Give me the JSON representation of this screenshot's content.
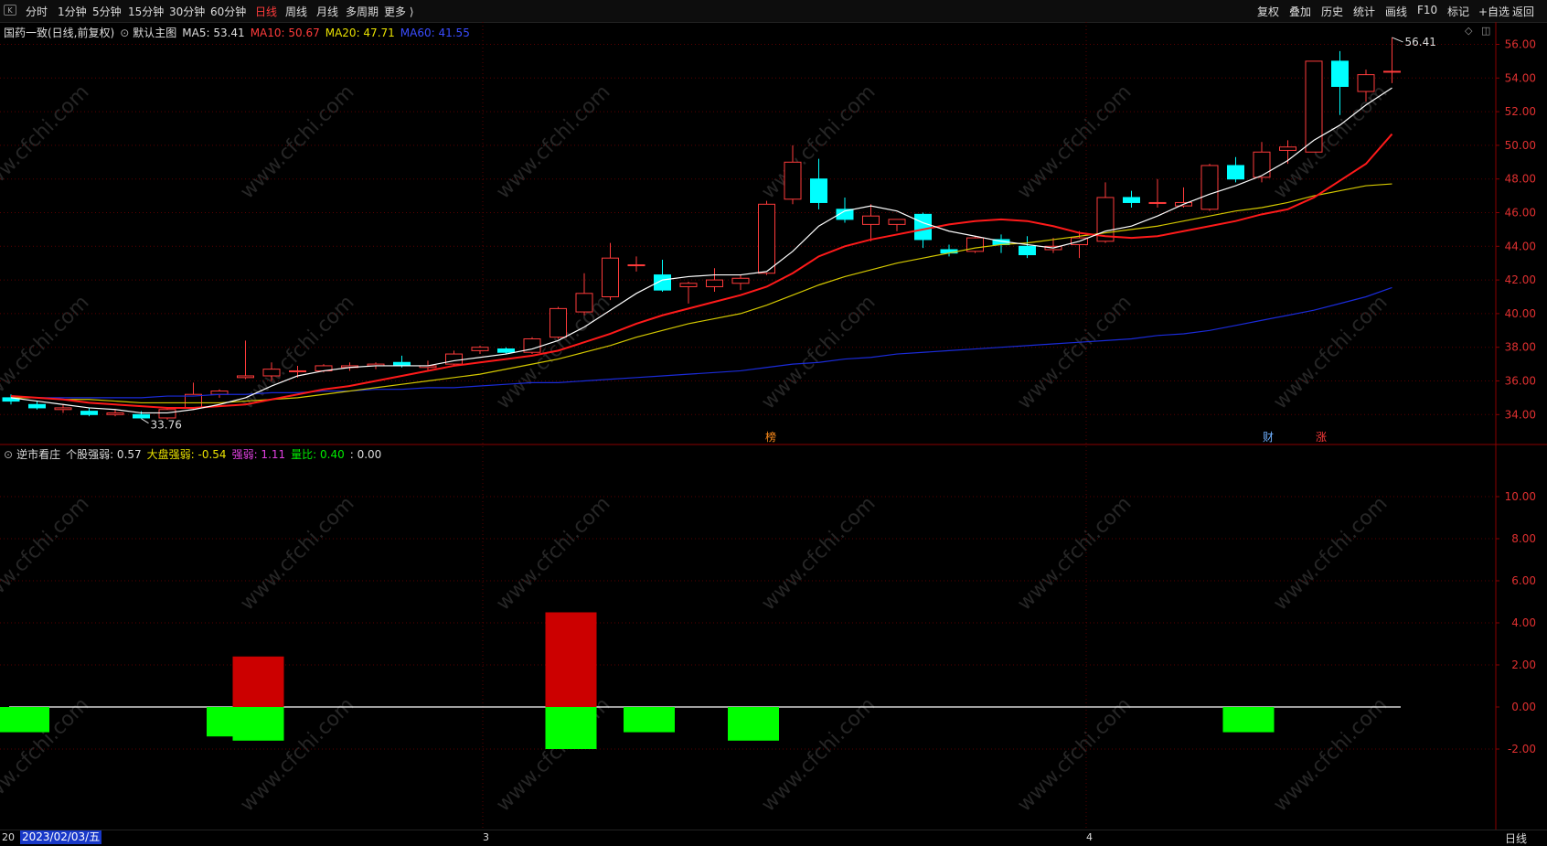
{
  "toolbar": {
    "icon_label": "K",
    "left_items": [
      "分时",
      "1分钟",
      "5分钟",
      "15分钟",
      "30分钟",
      "60分钟",
      "日线",
      "周线",
      "月线",
      "多周期",
      "更多 ⟩"
    ],
    "active_index": 6,
    "right_items": [
      "复权",
      "叠加",
      "历史",
      "统计",
      "画线",
      "F10",
      "标记",
      "+自选",
      "返回"
    ]
  },
  "main_legend": {
    "title": "国药一致(日线,前复权)",
    "indicator": "默认主图",
    "ma5": "MA5: 53.41",
    "ma10": "MA10: 50.67",
    "ma20": "MA20: 47.71",
    "ma60": "MA60: 41.55"
  },
  "sub_legend": {
    "title": "逆市看庄",
    "item1": "个股强弱: 0.57",
    "item2": "大盘强弱: -0.54",
    "item3": "强弱: 1.11",
    "item4": "量比: 0.40",
    "item5": ": 0.00"
  },
  "price_axis": [
    "56.00",
    "54.00",
    "52.00",
    "50.00",
    "48.00",
    "46.00",
    "44.00",
    "42.00",
    "40.00",
    "38.00",
    "36.00",
    "34.00"
  ],
  "sub_axis": [
    "10.00",
    "8.00",
    "6.00",
    "4.00",
    "2.00",
    "0.00",
    "-2.00"
  ],
  "annotations": {
    "high": "56.41",
    "low": "33.76"
  },
  "markers": {
    "m1": "榜",
    "m2": "财",
    "m3": "涨"
  },
  "watermark": "www.cfchi.com",
  "bottom": {
    "left_stub": "20",
    "date": "2023/02/03/五",
    "tick_3": "3",
    "tick_4": "4",
    "period": "日线"
  },
  "colors": {
    "up": "#ff3b3b",
    "down": "#00ffff",
    "ma5": "#ffffff",
    "ma10": "#ff1a1a",
    "ma20": "#d4c800",
    "ma60": "#1a2bd8",
    "pos_bar": "#cc0000",
    "neg_bar": "#00ff00"
  },
  "chart_data": [
    {
      "type": "candlestick",
      "title": "国药一致(日线,前复权)",
      "ylim": [
        33,
        57.5
      ],
      "candles": [
        {
          "o": 35.0,
          "h": 35.2,
          "l": 34.6,
          "c": 34.8
        },
        {
          "o": 34.6,
          "h": 34.8,
          "l": 34.3,
          "c": 34.4
        },
        {
          "o": 34.3,
          "h": 34.6,
          "l": 34.1,
          "c": 34.4
        },
        {
          "o": 34.2,
          "h": 34.4,
          "l": 33.9,
          "c": 34.0
        },
        {
          "o": 34.0,
          "h": 34.3,
          "l": 33.9,
          "c": 34.1
        },
        {
          "o": 34.0,
          "h": 34.2,
          "l": 33.76,
          "c": 33.8
        },
        {
          "o": 33.8,
          "h": 34.4,
          "l": 33.7,
          "c": 34.3
        },
        {
          "o": 34.4,
          "h": 35.9,
          "l": 34.3,
          "c": 35.2
        },
        {
          "o": 35.2,
          "h": 35.5,
          "l": 35.0,
          "c": 35.4
        },
        {
          "o": 36.2,
          "h": 38.4,
          "l": 36.1,
          "c": 36.3
        },
        {
          "o": 36.3,
          "h": 37.1,
          "l": 36.0,
          "c": 36.7
        },
        {
          "o": 36.6,
          "h": 36.9,
          "l": 36.2,
          "c": 36.6
        },
        {
          "o": 36.6,
          "h": 37.0,
          "l": 36.5,
          "c": 36.9
        },
        {
          "o": 36.8,
          "h": 37.1,
          "l": 36.6,
          "c": 36.9
        },
        {
          "o": 36.9,
          "h": 37.1,
          "l": 36.7,
          "c": 37.0
        },
        {
          "o": 37.1,
          "h": 37.5,
          "l": 36.8,
          "c": 36.9
        },
        {
          "o": 36.8,
          "h": 37.2,
          "l": 36.6,
          "c": 36.9
        },
        {
          "o": 37.0,
          "h": 37.8,
          "l": 36.9,
          "c": 37.6
        },
        {
          "o": 37.8,
          "h": 38.1,
          "l": 37.6,
          "c": 38.0
        },
        {
          "o": 37.9,
          "h": 38.0,
          "l": 37.6,
          "c": 37.7
        },
        {
          "o": 37.7,
          "h": 38.6,
          "l": 37.6,
          "c": 38.5
        },
        {
          "o": 38.6,
          "h": 40.4,
          "l": 38.5,
          "c": 40.3
        },
        {
          "o": 40.1,
          "h": 42.4,
          "l": 39.9,
          "c": 41.2
        },
        {
          "o": 41.0,
          "h": 44.2,
          "l": 40.8,
          "c": 43.3
        },
        {
          "o": 42.9,
          "h": 43.4,
          "l": 42.5,
          "c": 42.9
        },
        {
          "o": 42.3,
          "h": 43.2,
          "l": 41.3,
          "c": 41.4
        },
        {
          "o": 41.6,
          "h": 41.9,
          "l": 40.6,
          "c": 41.8
        },
        {
          "o": 41.6,
          "h": 42.7,
          "l": 41.3,
          "c": 42.0
        },
        {
          "o": 41.8,
          "h": 42.3,
          "l": 41.4,
          "c": 42.1
        },
        {
          "o": 42.4,
          "h": 46.7,
          "l": 42.3,
          "c": 46.5
        },
        {
          "o": 46.8,
          "h": 50.0,
          "l": 46.5,
          "c": 49.0
        },
        {
          "o": 48.0,
          "h": 49.2,
          "l": 46.2,
          "c": 46.6
        },
        {
          "o": 46.2,
          "h": 46.9,
          "l": 45.4,
          "c": 45.6
        },
        {
          "o": 45.3,
          "h": 46.5,
          "l": 44.3,
          "c": 45.8
        },
        {
          "o": 45.3,
          "h": 45.6,
          "l": 44.9,
          "c": 45.6
        },
        {
          "o": 45.9,
          "h": 46.0,
          "l": 43.9,
          "c": 44.4
        },
        {
          "o": 43.8,
          "h": 44.1,
          "l": 43.4,
          "c": 43.6
        },
        {
          "o": 43.7,
          "h": 44.6,
          "l": 43.6,
          "c": 44.5
        },
        {
          "o": 44.4,
          "h": 44.7,
          "l": 43.6,
          "c": 44.1
        },
        {
          "o": 44.0,
          "h": 44.6,
          "l": 43.3,
          "c": 43.5
        },
        {
          "o": 43.8,
          "h": 44.5,
          "l": 43.6,
          "c": 44.0
        },
        {
          "o": 44.1,
          "h": 44.9,
          "l": 43.3,
          "c": 44.5
        },
        {
          "o": 44.3,
          "h": 47.8,
          "l": 44.2,
          "c": 46.9
        },
        {
          "o": 46.9,
          "h": 47.3,
          "l": 46.3,
          "c": 46.6
        },
        {
          "o": 46.6,
          "h": 48.0,
          "l": 46.3,
          "c": 46.6
        },
        {
          "o": 46.4,
          "h": 47.5,
          "l": 46.3,
          "c": 46.6
        },
        {
          "o": 46.2,
          "h": 48.9,
          "l": 46.1,
          "c": 48.8
        },
        {
          "o": 48.8,
          "h": 49.3,
          "l": 47.8,
          "c": 48.0
        },
        {
          "o": 48.1,
          "h": 50.2,
          "l": 47.8,
          "c": 49.6
        },
        {
          "o": 49.7,
          "h": 50.3,
          "l": 48.9,
          "c": 49.9
        },
        {
          "o": 49.6,
          "h": 55.0,
          "l": 49.6,
          "c": 55.0
        },
        {
          "o": 55.0,
          "h": 55.6,
          "l": 51.8,
          "c": 53.5
        },
        {
          "o": 53.2,
          "h": 54.5,
          "l": 52.6,
          "c": 54.2
        },
        {
          "o": 54.4,
          "h": 56.41,
          "l": 53.7,
          "c": 54.4
        }
      ],
      "ma5": [
        35.0,
        34.8,
        34.6,
        34.4,
        34.3,
        34.1,
        34.1,
        34.3,
        34.6,
        35.0,
        35.7,
        36.3,
        36.6,
        36.8,
        36.9,
        36.9,
        36.9,
        37.2,
        37.4,
        37.6,
        37.9,
        38.4,
        39.2,
        40.2,
        41.2,
        42.0,
        42.2,
        42.3,
        42.3,
        42.5,
        43.7,
        45.2,
        46.1,
        46.4,
        46.1,
        45.4,
        44.9,
        44.6,
        44.3,
        44.1,
        43.9,
        44.3,
        44.9,
        45.2,
        45.8,
        46.5,
        47.1,
        47.6,
        48.2,
        49.1,
        50.3,
        51.2,
        52.4,
        53.41
      ],
      "ma10": [
        35.1,
        35.0,
        34.9,
        34.7,
        34.6,
        34.5,
        34.4,
        34.4,
        34.5,
        34.6,
        34.9,
        35.2,
        35.5,
        35.7,
        36.0,
        36.3,
        36.6,
        36.9,
        37.1,
        37.3,
        37.5,
        37.8,
        38.3,
        38.8,
        39.4,
        39.9,
        40.3,
        40.7,
        41.1,
        41.6,
        42.4,
        43.4,
        44.0,
        44.4,
        44.7,
        45.0,
        45.3,
        45.5,
        45.6,
        45.5,
        45.2,
        44.8,
        44.6,
        44.5,
        44.6,
        44.9,
        45.2,
        45.5,
        45.9,
        46.2,
        46.9,
        47.9,
        48.9,
        50.67
      ],
      "ma20": [
        35.0,
        35.0,
        34.9,
        34.9,
        34.8,
        34.7,
        34.7,
        34.7,
        34.7,
        34.8,
        34.9,
        35.0,
        35.2,
        35.4,
        35.6,
        35.8,
        36.0,
        36.2,
        36.4,
        36.7,
        37.0,
        37.3,
        37.7,
        38.1,
        38.6,
        39.0,
        39.4,
        39.7,
        40.0,
        40.5,
        41.1,
        41.7,
        42.2,
        42.6,
        43.0,
        43.3,
        43.6,
        43.9,
        44.1,
        44.2,
        44.4,
        44.6,
        44.8,
        45.0,
        45.2,
        45.5,
        45.8,
        46.1,
        46.3,
        46.6,
        47.0,
        47.3,
        47.6,
        47.71
      ],
      "ma60": [
        35.0,
        35.0,
        35.0,
        35.0,
        35.0,
        35.0,
        35.1,
        35.1,
        35.2,
        35.2,
        35.3,
        35.3,
        35.4,
        35.4,
        35.5,
        35.5,
        35.6,
        35.6,
        35.7,
        35.8,
        35.9,
        35.9,
        36.0,
        36.1,
        36.2,
        36.3,
        36.4,
        36.5,
        36.6,
        36.8,
        37.0,
        37.1,
        37.3,
        37.4,
        37.6,
        37.7,
        37.8,
        37.9,
        38.0,
        38.1,
        38.2,
        38.3,
        38.4,
        38.5,
        38.7,
        38.8,
        39.0,
        39.3,
        39.6,
        39.9,
        40.2,
        40.6,
        41.0,
        41.55
      ]
    },
    {
      "type": "bar",
      "title": "逆市看庄",
      "ylim": [
        -5.0,
        12.0
      ],
      "positive": [
        0,
        0,
        0,
        0,
        0,
        0,
        0,
        0,
        0,
        2.4,
        0,
        0,
        0,
        0,
        0,
        0,
        0,
        0,
        0,
        0,
        0,
        4.5,
        0,
        0,
        0,
        0,
        0,
        0,
        0,
        0,
        0,
        0,
        0,
        0,
        0,
        0,
        0,
        0,
        0,
        0,
        0,
        0,
        0,
        0,
        0,
        0,
        0,
        0,
        0,
        0,
        0,
        0,
        0,
        0
      ],
      "negative": [
        -1.2,
        0,
        0,
        0,
        0,
        0,
        0,
        0,
        -1.4,
        -1.6,
        0,
        0,
        0,
        0,
        0,
        0,
        0,
        0,
        0,
        0,
        0,
        -2.0,
        0,
        0,
        -1.2,
        0,
        0,
        0,
        -1.6,
        0,
        0,
        0,
        0,
        0,
        0,
        0,
        0,
        0,
        0,
        0,
        0,
        0,
        0,
        0,
        0,
        0,
        0,
        -1.2,
        0,
        0,
        0,
        0,
        0,
        0
      ]
    }
  ]
}
